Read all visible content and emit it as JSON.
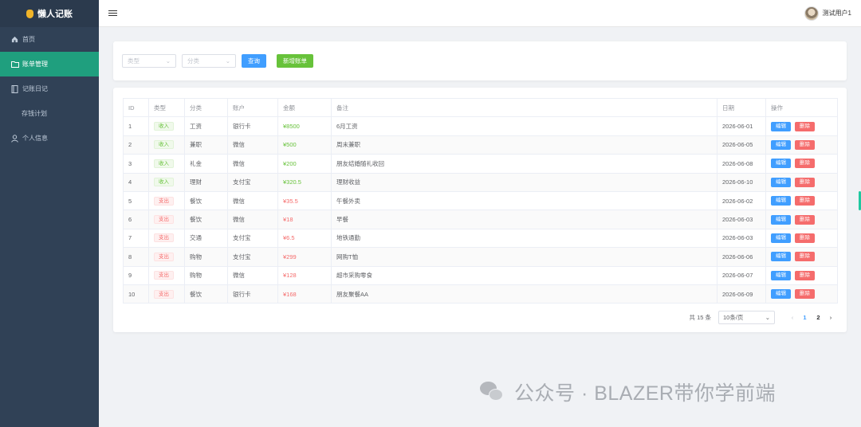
{
  "app": {
    "title": "懒人记账"
  },
  "sidebar": {
    "items": [
      {
        "label": "首页",
        "icon": "home-icon"
      },
      {
        "label": "账单管理",
        "icon": "folder-icon",
        "active": true
      },
      {
        "label": "记账日记",
        "icon": "book-icon"
      },
      {
        "label": "存钱计划",
        "icon": ""
      },
      {
        "label": "个人信息",
        "icon": "user-icon"
      }
    ]
  },
  "header": {
    "username": "测试用户1"
  },
  "filter": {
    "type_placeholder": "类型",
    "category_placeholder": "分类",
    "query_label": "查询",
    "add_label": "新增账单"
  },
  "table": {
    "columns": [
      "ID",
      "类型",
      "分类",
      "账户",
      "金额",
      "备注",
      "日期",
      "操作"
    ],
    "edit_label": "编辑",
    "delete_label": "删除",
    "rows": [
      {
        "id": "1",
        "type": "收入",
        "kind": "income",
        "category": "工资",
        "account": "银行卡",
        "amount": "¥8500",
        "note": "6月工资",
        "date": "2026-06-01"
      },
      {
        "id": "2",
        "type": "收入",
        "kind": "income",
        "category": "兼职",
        "account": "微信",
        "amount": "¥500",
        "note": "周末兼职",
        "date": "2026-06-05"
      },
      {
        "id": "3",
        "type": "收入",
        "kind": "income",
        "category": "礼金",
        "account": "微信",
        "amount": "¥200",
        "note": "朋友结婚随礼收回",
        "date": "2026-06-08"
      },
      {
        "id": "4",
        "type": "收入",
        "kind": "income",
        "category": "理财",
        "account": "支付宝",
        "amount": "¥320.5",
        "note": "理财收益",
        "date": "2026-06-10"
      },
      {
        "id": "5",
        "type": "支出",
        "kind": "expense",
        "category": "餐饮",
        "account": "微信",
        "amount": "¥35.5",
        "note": "午餐外卖",
        "date": "2026-06-02"
      },
      {
        "id": "6",
        "type": "支出",
        "kind": "expense",
        "category": "餐饮",
        "account": "微信",
        "amount": "¥18",
        "note": "早餐",
        "date": "2026-06-03"
      },
      {
        "id": "7",
        "type": "支出",
        "kind": "expense",
        "category": "交通",
        "account": "支付宝",
        "amount": "¥6.5",
        "note": "地铁通勤",
        "date": "2026-06-03"
      },
      {
        "id": "8",
        "type": "支出",
        "kind": "expense",
        "category": "购物",
        "account": "支付宝",
        "amount": "¥299",
        "note": "网购T恤",
        "date": "2026-06-06"
      },
      {
        "id": "9",
        "type": "支出",
        "kind": "expense",
        "category": "购物",
        "account": "微信",
        "amount": "¥128",
        "note": "超市采购零食",
        "date": "2026-06-07"
      },
      {
        "id": "10",
        "type": "支出",
        "kind": "expense",
        "category": "餐饮",
        "account": "银行卡",
        "amount": "¥168",
        "note": "朋友聚餐AA",
        "date": "2026-06-09"
      }
    ]
  },
  "pagination": {
    "total_text": "共 15 条",
    "page_size": "10条/页",
    "pages": [
      "1",
      "2"
    ],
    "current": "1"
  },
  "watermark": {
    "text": "公众号 · BLAZER带你学前端"
  },
  "colors": {
    "sidebar": "#304156",
    "active": "#1f9f7e",
    "primary": "#409eff",
    "success": "#67c23a",
    "danger": "#f56c6c"
  }
}
